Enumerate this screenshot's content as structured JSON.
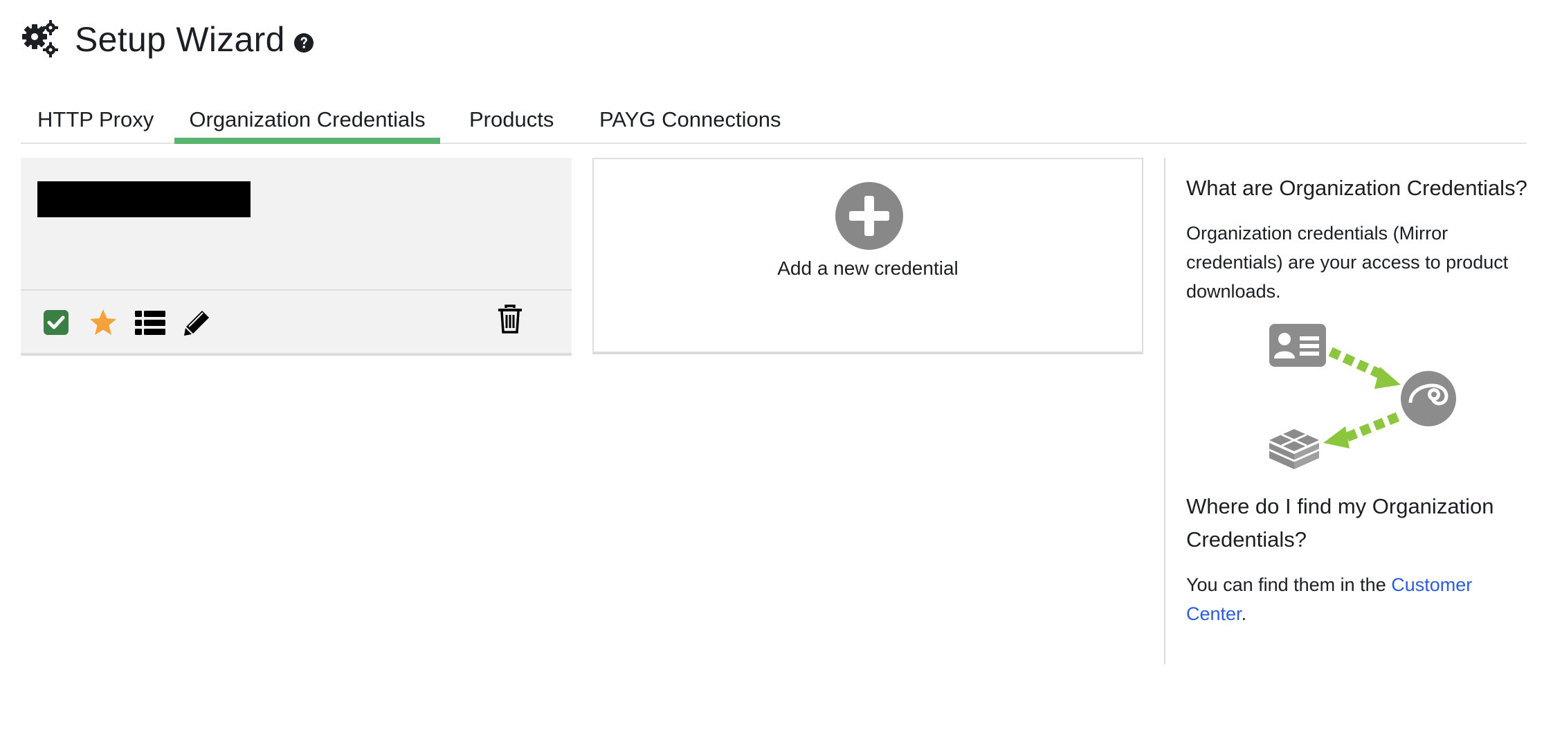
{
  "header": {
    "title": "Setup Wizard",
    "gear_icon": "gears-icon",
    "help_icon": "question-circle-icon"
  },
  "tabs": [
    {
      "label": "HTTP Proxy",
      "active": false
    },
    {
      "label": "Organization Credentials",
      "active": true
    },
    {
      "label": "Products",
      "active": false
    },
    {
      "label": "PAYG Connections",
      "active": false
    }
  ],
  "credential_card": {
    "name": "[redacted]",
    "actions": [
      "check-square-icon",
      "star-icon",
      "list-icon",
      "pencil-icon"
    ],
    "delete_icon": "trash-icon",
    "colors": {
      "check": "#3b7f45",
      "star": "#f4a23a"
    }
  },
  "add_card": {
    "label": "Add a new credential",
    "icon": "plus-circle-icon"
  },
  "info": {
    "heading1": "What are Organization Credentials?",
    "text1": "Organization credentials (Mirror credentials) are your access to product downloads.",
    "illustration": "credentials-flow-illustration",
    "heading2": "Where do I find my Organization Credentials?",
    "text2_prefix": "You can find them in the ",
    "link_label": "Customer Center",
    "text2_suffix": "."
  },
  "colors": {
    "accent": "#58b46e",
    "link": "#2e5cd9"
  }
}
